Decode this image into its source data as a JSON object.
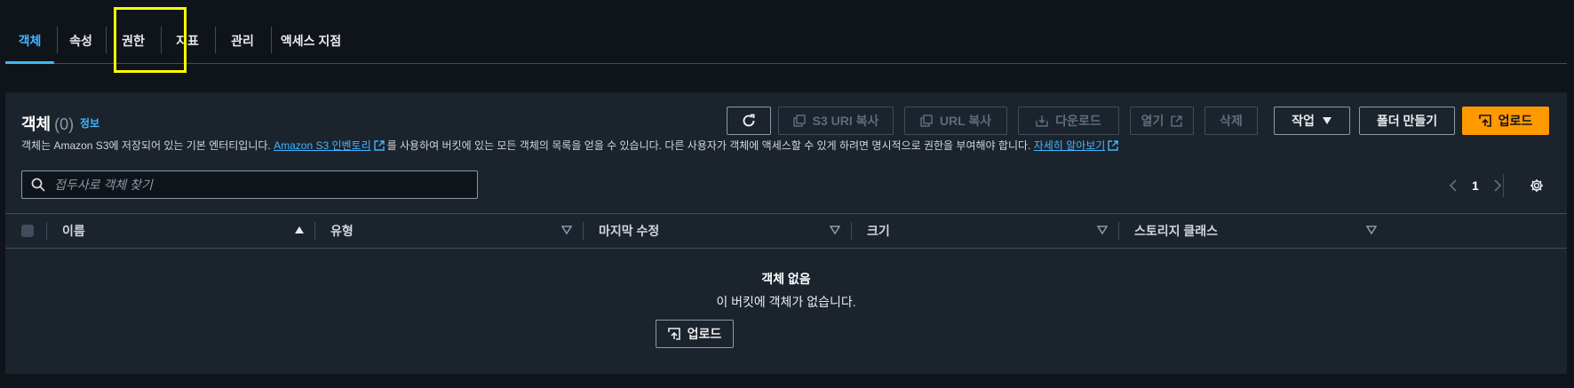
{
  "tabs": [
    {
      "label": "객체"
    },
    {
      "label": "속성"
    },
    {
      "label": "권한"
    },
    {
      "label": "지표"
    },
    {
      "label": "관리"
    },
    {
      "label": "액세스 지점"
    }
  ],
  "panel": {
    "title": "객체",
    "count": "(0)",
    "info_link": "정보",
    "desc_before": "객체는 Amazon S3에 저장되어 있는 기본 엔터티입니다.",
    "desc_link1": "Amazon S3 인벤토리",
    "desc_middle": "를 사용하여 버킷에 있는 모든 객체의 목록을 얻을 수 있습니다. 다른 사용자가 객체에 액세스할 수 있게 하려면 명시적으로 권한을 부여해야 합니다.",
    "desc_link2": "자세히 알아보기"
  },
  "toolbar": {
    "refresh_label": "",
    "copy_s3_uri": "S3 URI 복사",
    "copy_url": "URL 복사",
    "download": "다운로드",
    "open": "열기",
    "delete": "삭제",
    "actions": "작업",
    "create_folder": "폴더 만들기",
    "upload": "업로드"
  },
  "search": {
    "placeholder": "접두사로 객체 찾기"
  },
  "pagination": {
    "current_page": "1"
  },
  "table": {
    "columns": [
      "이름",
      "유형",
      "마지막 수정",
      "크기",
      "스토리지 클래스"
    ]
  },
  "empty_state": {
    "title": "객체 없음",
    "subtitle": "이 버킷에 객체가 없습니다.",
    "upload_label": "업로드"
  },
  "colors": {
    "accent": "#42b4ff",
    "primary_button": "#ff9900",
    "highlight": "#ffff00"
  }
}
